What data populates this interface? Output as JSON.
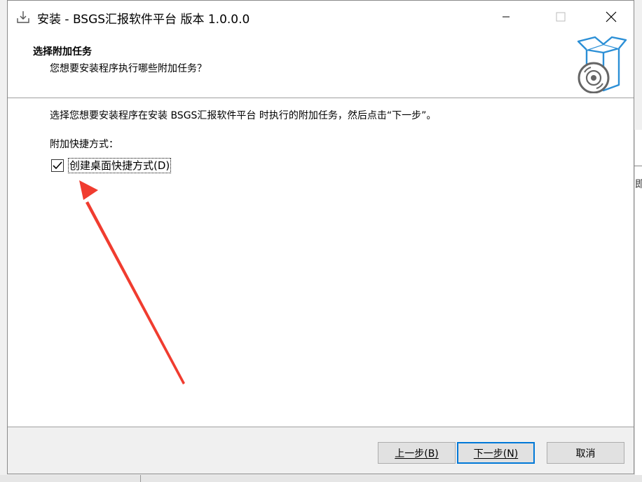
{
  "window": {
    "title": "安装 - BSGS汇报软件平台 版本 1.0.0.0",
    "icon": "installer-icon"
  },
  "header": {
    "title": "选择附加任务",
    "subtitle": "您想要安装程序执行哪些附加任务？",
    "image": "install-disc-box-icon"
  },
  "main": {
    "instruction": "选择您想要安装程序在安装 BSGS汇报软件平台 时执行的附加任务，然后点击“下一步”。",
    "group_label": "附加快捷方式：",
    "checkbox": {
      "label": "创建桌面快捷方式(D)",
      "checked": true
    }
  },
  "annotation": {
    "color": "#f03c2f",
    "shape": "red-arrow"
  },
  "footer": {
    "back_label": "上一步(B)",
    "next_label": "下一步(N)",
    "cancel_label": "取消"
  },
  "colors": {
    "accent": "#0078d7",
    "icon_blue": "#2b8fd6"
  }
}
